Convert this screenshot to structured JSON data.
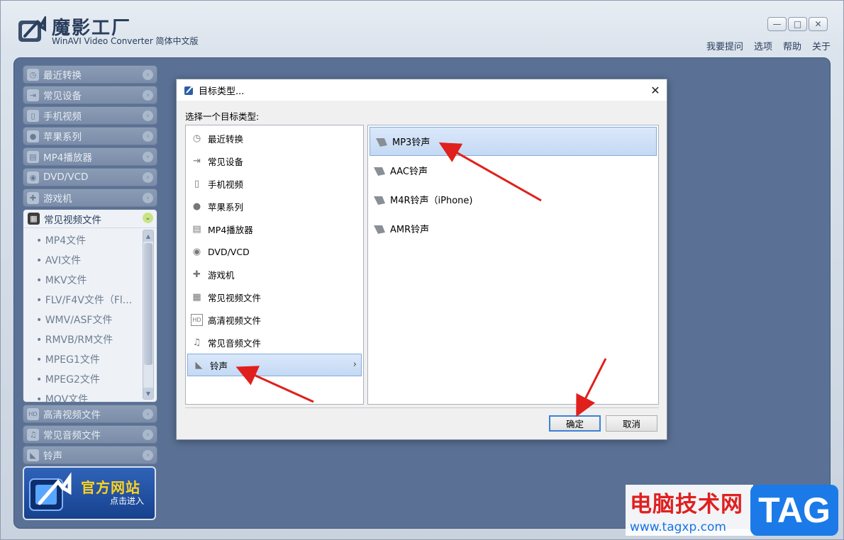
{
  "app": {
    "title": "魔影工厂",
    "subtitle": "WinAVI Video Converter 简体中文版",
    "window_controls": [
      "—",
      "□",
      "✕"
    ],
    "menu": [
      "我要提问",
      "选项",
      "帮助",
      "关于"
    ]
  },
  "sidebar": {
    "items_top": [
      {
        "label": "最近转换",
        "icon": "clock-icon"
      },
      {
        "label": "常见设备",
        "icon": "device-icon"
      },
      {
        "label": "手机视频",
        "icon": "phone-icon"
      },
      {
        "label": "苹果系列",
        "icon": "apple-icon"
      },
      {
        "label": "MP4播放器",
        "icon": "mp4-player-icon"
      },
      {
        "label": "DVD/VCD",
        "icon": "disc-icon"
      },
      {
        "label": "游戏机",
        "icon": "gamepad-icon"
      }
    ],
    "expanded": {
      "label": "常见视频文件",
      "sub_items": [
        "MP4文件",
        "AVI文件",
        "MKV文件",
        "FLV/F4V文件（Fl...",
        "WMV/ASF文件",
        "RMVB/RM文件",
        "MPEG1文件",
        "MPEG2文件",
        "MOV文件"
      ]
    },
    "items_bottom": [
      {
        "label": "高清视频文件",
        "icon": "hd-icon"
      },
      {
        "label": "常见音频文件",
        "icon": "music-icon"
      },
      {
        "label": "铃声",
        "icon": "ringtone-icon"
      }
    ],
    "banner": {
      "title": "官方网站",
      "subtitle": "点击进入"
    }
  },
  "dialog": {
    "title": "目标类型...",
    "prompt": "选择一个目标类型:",
    "categories": [
      {
        "label": "最近转换",
        "icon": "clock-icon"
      },
      {
        "label": "常见设备",
        "icon": "device-icon"
      },
      {
        "label": "手机视频",
        "icon": "phone-icon"
      },
      {
        "label": "苹果系列",
        "icon": "apple-icon"
      },
      {
        "label": "MP4播放器",
        "icon": "mp4-player-icon"
      },
      {
        "label": "DVD/VCD",
        "icon": "disc-icon"
      },
      {
        "label": "游戏机",
        "icon": "gamepad-icon"
      },
      {
        "label": "常见视频文件",
        "icon": "film-icon"
      },
      {
        "label": "高清视频文件",
        "icon": "hd-icon"
      },
      {
        "label": "常见音频文件",
        "icon": "music-icon"
      },
      {
        "label": "铃声",
        "icon": "ringtone-icon"
      }
    ],
    "selected_category": "铃声",
    "ringtones": [
      "MP3铃声",
      "AAC铃声",
      "M4R铃声（iPhone)",
      "AMR铃声"
    ],
    "selected_ringtone": "MP3铃声",
    "ok_label": "确定",
    "cancel_label": "取消"
  },
  "watermark": {
    "text": "电脑技术网",
    "url": "www.tagxp.com",
    "tag": "TAG"
  },
  "colors": {
    "accent_arrow": "#e0201c",
    "content_bg": "#5a7195",
    "selection": "#c4d9f4"
  }
}
